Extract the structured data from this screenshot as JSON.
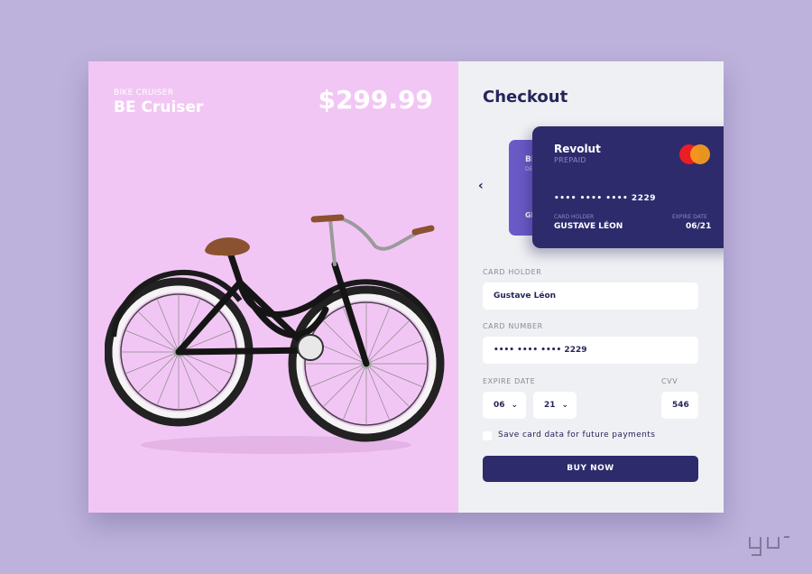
{
  "product": {
    "subtitle": "BIKE CRUISER",
    "name": "BE Cruiser",
    "price": "$299.99"
  },
  "checkout": {
    "title": "Checkout",
    "back_card": {
      "name": "BN",
      "type": "DE",
      "holder": "GI"
    },
    "card": {
      "bank": "Revolut",
      "type": "PREPAID",
      "number": "•••• •••• •••• 2229",
      "holder_label": "CARD HOLDER",
      "holder": "GUSTAVE LÉON",
      "expire_label": "EXPIRE DATE",
      "expire": "06/21"
    },
    "fields": {
      "card_holder_label": "CARD HOLDER",
      "card_holder_value": "Gustave Léon",
      "card_number_label": "CARD NUMBER",
      "card_number_value": "•••• •••• •••• 2229",
      "expire_label": "EXPIRE DATE",
      "month": "06",
      "year": "21",
      "cvv_label": "CVV",
      "cvv_value": "546"
    },
    "save_label": "Save card data for future payments",
    "buy_label": "BUY NOW"
  },
  "colors": {
    "background": "#bdb2db",
    "product_panel": "#f2c6f4",
    "checkout_panel": "#eef0f3",
    "primary": "#2d2b6b",
    "secondary_card": "#6a5ac7"
  },
  "icons": [
    "chevron-left-icon",
    "chevron-down-icon",
    "mastercard-logo-icon"
  ]
}
